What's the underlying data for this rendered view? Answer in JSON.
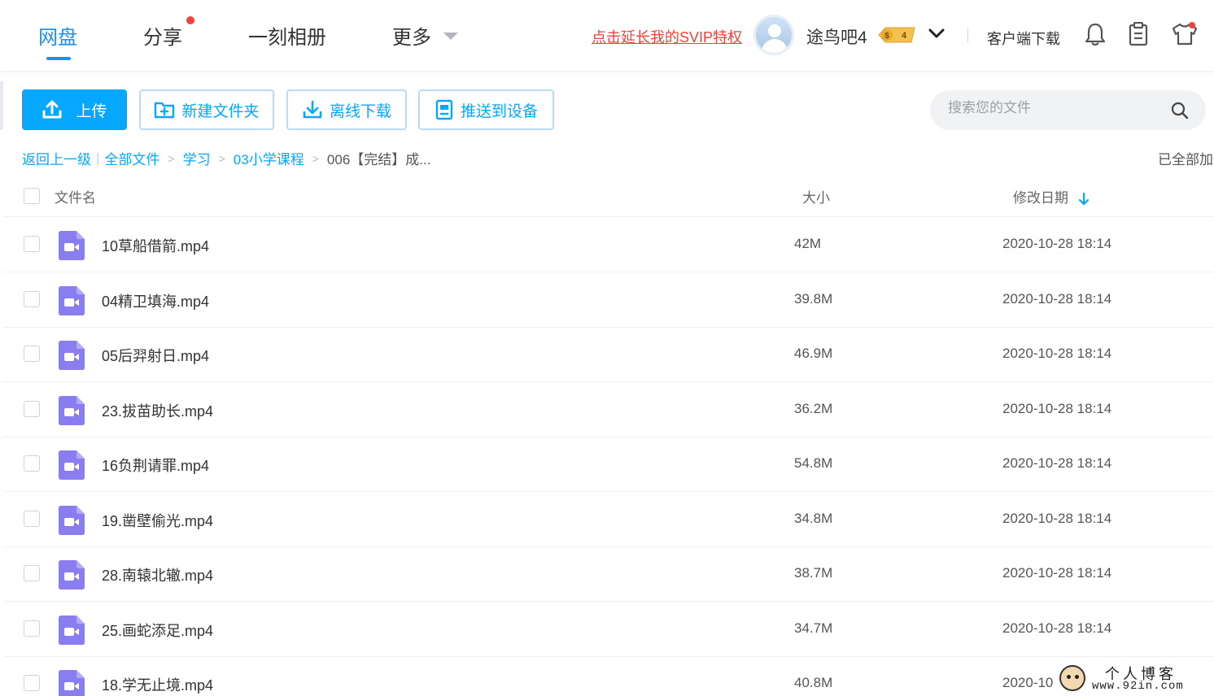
{
  "nav": {
    "tabs": [
      {
        "label": "网盘"
      },
      {
        "label": "分享"
      },
      {
        "label": "一刻相册"
      },
      {
        "label": "更多"
      }
    ],
    "svip_link": "点击延长我的SVIP特权",
    "username": "途鸟吧4",
    "vip_badge_level": "4",
    "client_download": "客户端下载",
    "accent_color": "#06a7ff",
    "alert_color": "#f5413b"
  },
  "toolbar": {
    "upload": "上传",
    "new_folder": "新建文件夹",
    "offline_download": "离线下载",
    "push_device": "推送到设备",
    "search_placeholder": "搜索您的文件"
  },
  "breadcrumb": {
    "back": "返回上一级",
    "items": [
      "全部文件",
      "学习",
      "03小学课程"
    ],
    "current": "006【完结】成...",
    "status": "已全部加"
  },
  "table": {
    "columns": {
      "name": "文件名",
      "size": "大小",
      "date": "修改日期"
    },
    "rows": [
      {
        "name": "10草船借箭.mp4",
        "size": "42M",
        "date": "2020-10-28 18:14"
      },
      {
        "name": "04精卫填海.mp4",
        "size": "39.8M",
        "date": "2020-10-28 18:14"
      },
      {
        "name": "05后羿射日.mp4",
        "size": "46.9M",
        "date": "2020-10-28 18:14"
      },
      {
        "name": "23.拔苗助长.mp4",
        "size": "36.2M",
        "date": "2020-10-28 18:14"
      },
      {
        "name": "16负荆请罪.mp4",
        "size": "54.8M",
        "date": "2020-10-28 18:14"
      },
      {
        "name": "19.凿壁偷光.mp4",
        "size": "34.8M",
        "date": "2020-10-28 18:14"
      },
      {
        "name": "28.南辕北辙.mp4",
        "size": "38.7M",
        "date": "2020-10-28 18:14"
      },
      {
        "name": "25.画蛇添足.mp4",
        "size": "34.7M",
        "date": "2020-10-28 18:14"
      },
      {
        "name": "18.学无止境.mp4",
        "size": "40.8M",
        "date": "2020-10"
      }
    ]
  },
  "watermark": {
    "title": "个人博客",
    "url": "www.92in.com"
  }
}
